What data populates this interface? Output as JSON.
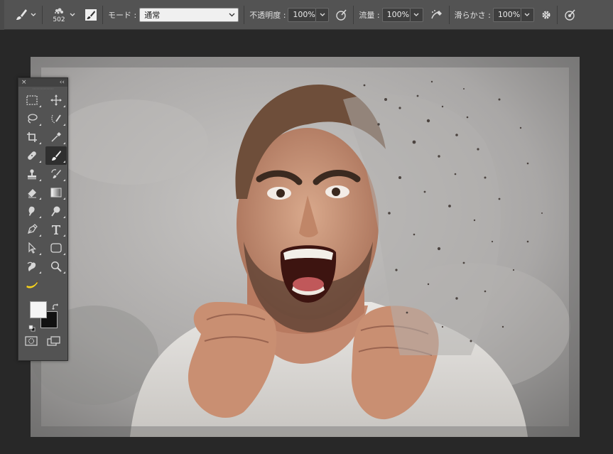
{
  "options_bar": {
    "brush_size": "502",
    "mode_label": "モード :",
    "mode_value": "通常",
    "opacity_label": "不透明度 :",
    "opacity_value": "100%",
    "flow_label": "流量 :",
    "flow_value": "100%",
    "smoothing_label": "滑らかさ :",
    "smoothing_value": "100%"
  },
  "tools_panel": {
    "close_glyph": "×",
    "collapse_glyph": "‹‹",
    "tools": [
      {
        "name": "rectangular-marquee-tool",
        "icon": "marquee-icon"
      },
      {
        "name": "move-tool",
        "icon": "move-icon"
      },
      {
        "name": "lasso-tool",
        "icon": "lasso-icon"
      },
      {
        "name": "quick-selection-tool",
        "icon": "quick-selection-icon"
      },
      {
        "name": "crop-tool",
        "icon": "crop-icon"
      },
      {
        "name": "eyedropper-tool",
        "icon": "eyedropper-icon"
      },
      {
        "name": "healing-brush-tool",
        "icon": "bandage-icon"
      },
      {
        "name": "brush-tool",
        "icon": "brush-icon",
        "active": true
      },
      {
        "name": "clone-stamp-tool",
        "icon": "stamp-icon"
      },
      {
        "name": "history-brush-tool",
        "icon": "history-brush-icon"
      },
      {
        "name": "eraser-tool",
        "icon": "eraser-icon"
      },
      {
        "name": "gradient-tool",
        "icon": "gradient-icon"
      },
      {
        "name": "smudge-tool",
        "icon": "smudge-icon"
      },
      {
        "name": "dodge-tool",
        "icon": "dodge-icon"
      },
      {
        "name": "pen-tool",
        "icon": "pen-icon"
      },
      {
        "name": "type-tool",
        "icon": "type-icon"
      },
      {
        "name": "path-selection-tool",
        "icon": "path-selection-icon"
      },
      {
        "name": "rectangle-tool",
        "icon": "rounded-rectangle-icon"
      },
      {
        "name": "3d-rotate-tool",
        "icon": "3d-rotate-icon"
      },
      {
        "name": "zoom-tool",
        "icon": "zoom-icon"
      }
    ],
    "extra_tool_icon": "banana-icon",
    "foreground_color": "#f4f4f4",
    "background_color": "#111111"
  }
}
